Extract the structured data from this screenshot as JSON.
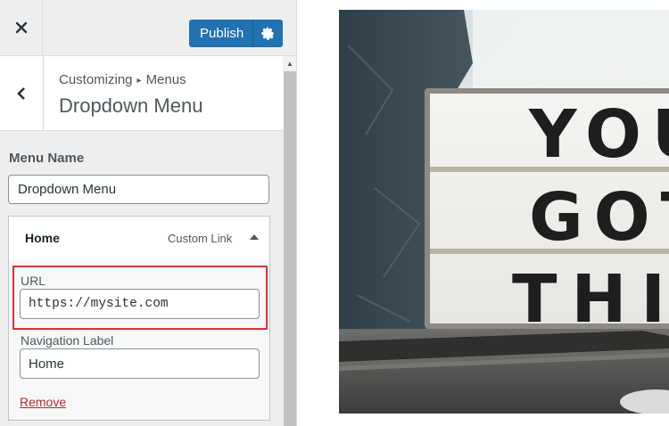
{
  "topbar": {
    "close_icon": "close-icon",
    "publish_label": "Publish",
    "settings_icon": "gear-icon"
  },
  "section": {
    "breadcrumb_root": "Customizing",
    "breadcrumb_separator": "▸",
    "breadcrumb_current": "Menus",
    "title": "Dropdown Menu"
  },
  "menu_name": {
    "label": "Menu Name",
    "value": "Dropdown Menu"
  },
  "menu_item": {
    "title": "Home",
    "type": "Custom Link",
    "expanded": true,
    "url_label": "URL",
    "url_value": "https://mysite.com",
    "nav_label": "Navigation Label",
    "nav_value": "Home",
    "remove_label": "Remove"
  },
  "preview": {
    "sign_lines": [
      "YOU",
      "GOT",
      "THIS"
    ]
  },
  "colors": {
    "accent": "#2271b1",
    "highlight": "#d63638",
    "remove_link": "#b32d2e",
    "panel_bg": "#eeeeee"
  }
}
